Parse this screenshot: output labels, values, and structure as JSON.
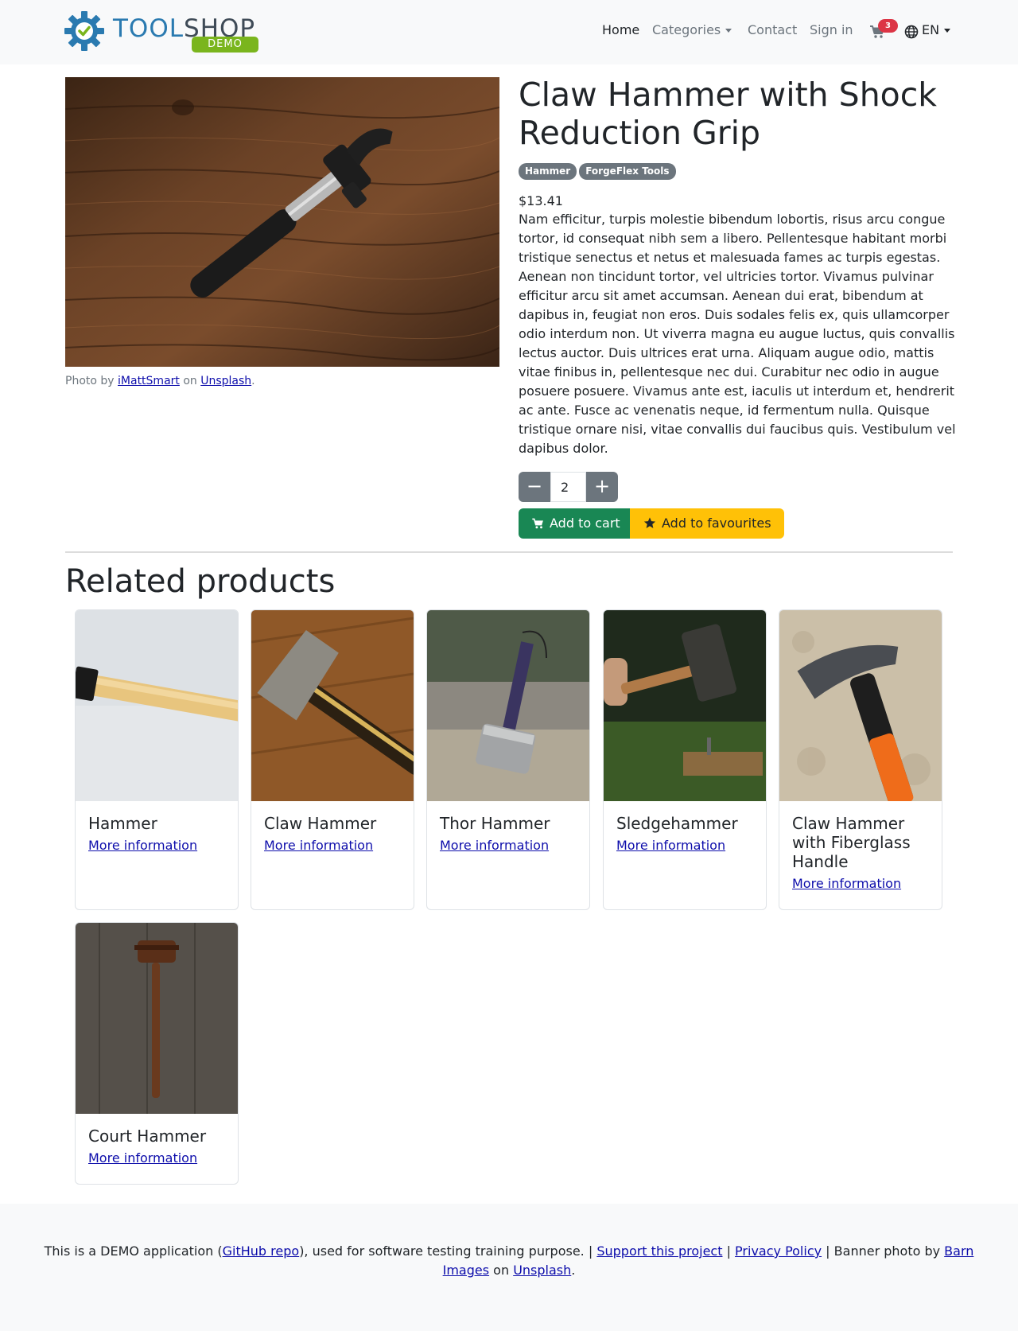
{
  "header": {
    "logo_text_1": "TOOL",
    "logo_text_2": "SHOP",
    "logo_badge": "DEMO",
    "nav": {
      "home": "Home",
      "categories": "Categories",
      "contact": "Contact",
      "sign_in": "Sign in",
      "cart_count": "3",
      "language": "EN"
    },
    "icons": [
      "gear-logo-icon",
      "cart-icon",
      "globe-icon"
    ]
  },
  "product": {
    "title": "Claw Hammer with Shock Reduction Grip",
    "tags": [
      "Hammer",
      "ForgeFlex Tools"
    ],
    "price": "$13.41",
    "description": "Nam efficitur, turpis molestie bibendum lobortis, risus arcu congue tortor, id consequat nibh sem a libero. Pellentesque habitant morbi tristique senectus et netus et malesuada fames ac turpis egestas. Aenean non tincidunt tortor, vel ultricies tortor. Vivamus pulvinar efficitur arcu sit amet accumsan. Aenean dui erat, bibendum at dapibus in, feugiat non eros. Duis sodales felis ex, quis ullamcorper odio interdum non. Ut viverra magna eu augue luctus, quis convallis lectus auctor. Duis ultrices erat urna. Aliquam augue odio, mattis vitae finibus in, pellentesque nec dui. Curabitur nec odio in augue posuere posuere. Vivamus ante est, iaculis ut interdum et, hendrerit ac ante. Fusce ac venenatis neque, id fermentum nulla. Quisque tristique ornare nisi, vitae convallis dui faucibus quis. Vestibulum vel dapibus dolor.",
    "quantity": "2",
    "qty_minus": "−",
    "qty_plus": "+",
    "add_to_cart": "Add to cart",
    "add_to_favourites": "Add to favourites",
    "photo_credit": {
      "prefix": "Photo by ",
      "author": "iMattSmart",
      "middle": " on ",
      "site": "Unsplash",
      "suffix": "."
    }
  },
  "related": {
    "heading": "Related products",
    "link_label": "More information",
    "items": [
      {
        "name": "Hammer"
      },
      {
        "name": "Claw Hammer"
      },
      {
        "name": "Thor Hammer"
      },
      {
        "name": "Sledgehammer"
      },
      {
        "name": "Claw Hammer with Fiberglass Handle"
      },
      {
        "name": "Court Hammer"
      }
    ]
  },
  "footer": {
    "text1": "This is a DEMO application (",
    "github": "GitHub repo",
    "text2": "), used for software testing training purpose. | ",
    "support": "Support this project",
    "sep1": " | ",
    "privacy": "Privacy Policy",
    "text3": " | Banner photo by ",
    "barn": "Barn Images",
    "text4": " on ",
    "unsplash": "Unsplash",
    "text5": "."
  },
  "colors": {
    "success": "#198754",
    "warning": "#ffc107",
    "secondary": "#6c757d",
    "danger": "#dc3545",
    "logo_blue": "#2a7ab0",
    "logo_green": "#7ab51d"
  }
}
